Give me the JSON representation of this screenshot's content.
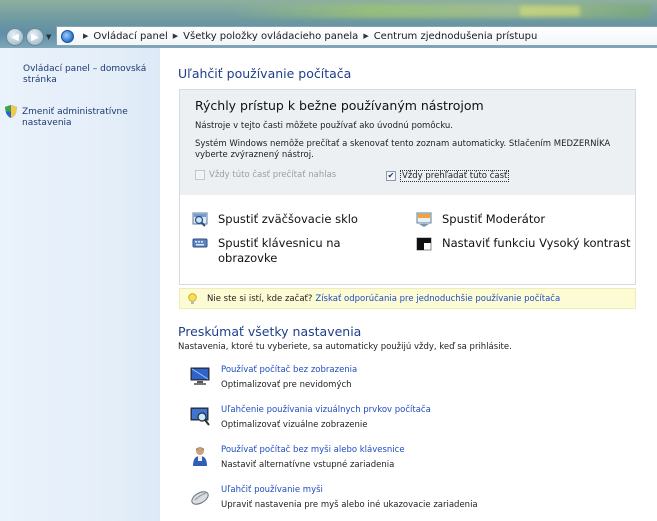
{
  "address": {
    "crumbs": [
      "Ovládací panel",
      "Všetky položky ovládacieho panela",
      "Centrum zjednodušenia prístupu"
    ]
  },
  "sidebar": {
    "home_link": "Ovládací panel – domovská stránka",
    "admin_link": "Zmeniť administratívne nastavenia"
  },
  "main": {
    "title": "Uľahčiť používanie počítača",
    "quick": {
      "heading": "Rýchly prístup k bežne používaným nástrojom",
      "desc1": "Nástroje v tejto časti môžete používať ako úvodnú pomôcku.",
      "desc2": "Systém Windows nemôže prečítať a skenovať tento zoznam automaticky. Stlačením MEDZERNÍKA vyberte zvýraznený nástroj.",
      "read_aloud": {
        "label": "Vždy túto časť prečítať nahlas",
        "checked": false,
        "enabled": false
      },
      "scan": {
        "label": "Vždy prehľadať túto časť",
        "checked": true,
        "enabled": true
      },
      "tools": [
        {
          "label": "Spustiť zväčšovacie sklo",
          "icon": "magnifier-icon"
        },
        {
          "label": "Spustiť Moderátor",
          "icon": "narrator-icon"
        },
        {
          "label": "Spustiť klávesnicu na obrazovke",
          "icon": "keyboard-icon"
        },
        {
          "label": "Nastaviť funkciu Vysoký kontrast",
          "icon": "high-contrast-icon"
        }
      ]
    },
    "hint": {
      "text": "Nie ste si istí, kde začať?",
      "link": "Získať odporúčania pre jednoduchšie používanie počítača"
    },
    "explore": {
      "title": "Preskúmať všetky nastavenia",
      "desc": "Nastavenia, ktoré tu vyberiete, sa automaticky použijú vždy, keď sa prihlásite.",
      "items": [
        {
          "link": "Používať počítač bez zobrazenia",
          "desc": "Optimalizovať pre nevidomých",
          "icon": "monitor-icon"
        },
        {
          "link": "Uľahčenie používania vizuálnych prvkov počítača",
          "desc": "Optimalizovať vizuálne zobrazenie",
          "icon": "display-magnify-icon"
        },
        {
          "link": "Používať počítač bez myši alebo klávesnice",
          "desc": "Nastaviť alternatívne vstupné zariadenia",
          "icon": "person-icon"
        },
        {
          "link": "Uľahčiť používanie myši",
          "desc": "Upraviť nastavenia pre myš alebo iné ukazovacie zariadenia",
          "icon": "mouse-icon"
        }
      ]
    }
  },
  "colors": {
    "link": "#1f4cc2",
    "title": "#1e3f8a",
    "sidebar": "#e4eef9",
    "hint_bg": "#fdfbd3"
  }
}
